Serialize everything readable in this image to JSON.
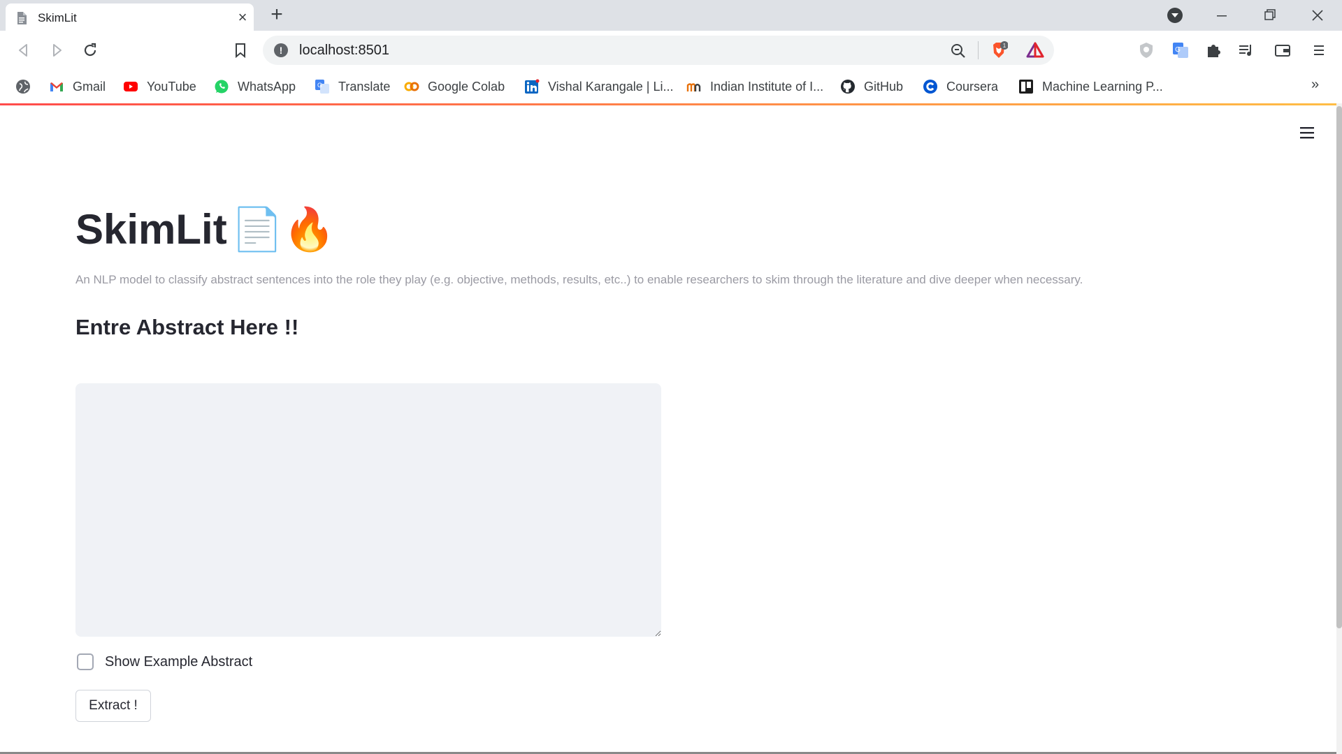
{
  "browser": {
    "tab_title": "SkimLit",
    "url": "localhost:8501",
    "brave_badge": "1"
  },
  "bookmarks": [
    {
      "label": "Gmail",
      "icon": "gmail-icon"
    },
    {
      "label": "YouTube",
      "icon": "youtube-icon"
    },
    {
      "label": "WhatsApp",
      "icon": "whatsapp-icon"
    },
    {
      "label": "Translate",
      "icon": "translate-icon"
    },
    {
      "label": "Google Colab",
      "icon": "colab-icon"
    },
    {
      "label": "Vishal Karangale | Li...",
      "icon": "linkedin-icon"
    },
    {
      "label": "Indian Institute of I...",
      "icon": "institute-icon"
    },
    {
      "label": "GitHub",
      "icon": "github-icon"
    },
    {
      "label": "Coursera",
      "icon": "coursera-icon"
    },
    {
      "label": "Machine Learning P...",
      "icon": "trello-icon"
    }
  ],
  "app": {
    "title": "SkimLit",
    "title_emoji": "📄🔥",
    "subtitle": "An NLP model to classify abstract sentences into the role they play (e.g. objective, methods, results, etc..) to enable researchers to skim through the literature and dive deeper when necessary.",
    "heading": "Entre Abstract Here !!",
    "textarea_value": "",
    "checkbox_label": "Show Example Abstract",
    "checkbox_checked": false,
    "button_label": "Extract !"
  },
  "colors": {
    "accent_gradient_start": "#ff4b4b",
    "accent_gradient_end": "#ffbd45",
    "input_bg": "#f0f2f6",
    "text_dark": "#262730"
  }
}
